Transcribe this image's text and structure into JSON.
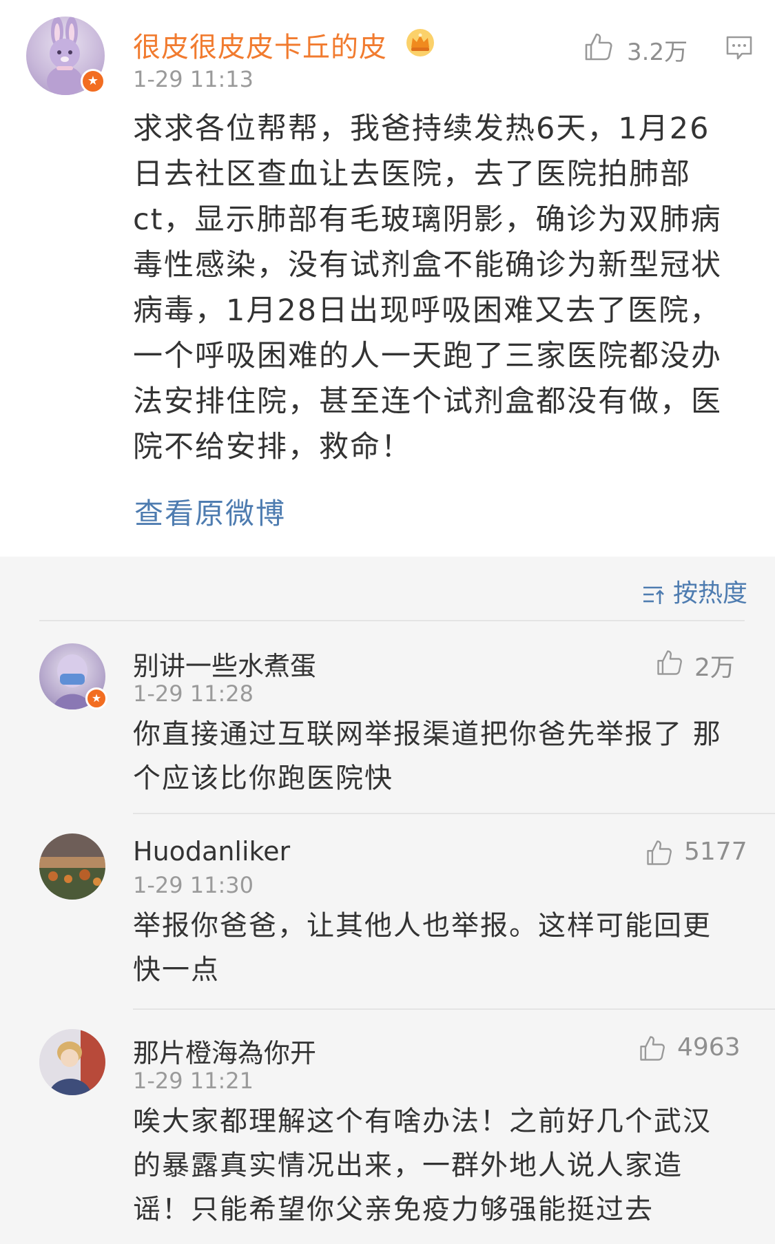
{
  "post": {
    "author": "很皮很皮皮卡丘的皮",
    "time": "1-29 11:13",
    "like_count": "3.2万",
    "text": "求求各位帮帮，我爸持续发热6天，1月26日去社区查血让去医院，去了医院拍肺部ct，显示肺部有毛玻璃阴影，确诊为双肺病毒性感染，没有试剂盒不能确诊为新型冠状病毒，1月28日出现呼吸困难又去了医院，一个呼吸困难的人一天跑了三家医院都没办法安排住院，甚至连个试剂盒都没有做，医院不给安排，救命！",
    "view_original": "查看原微博"
  },
  "sort_label": "按热度",
  "comments": [
    {
      "name": "别讲一些水煮蛋",
      "time": "1-29 11:28",
      "likes": "2万",
      "text": "你直接通过互联网举报渠道把你爸先举报了 那个应该比你跑医院快"
    },
    {
      "name": "Huodanliker",
      "time": "1-29 11:30",
      "likes": "5177",
      "text": "举报你爸爸，让其他人也举报。这样可能回更快一点"
    },
    {
      "name": "那片橙海為你开",
      "time": "1-29 11:21",
      "likes": "4963",
      "text": "唉大家都理解这个有啥办法！之前好几个武汉的暴露真实情况出来，一群外地人说人家造谣！只能希望你父亲免疫力够强能挺过去"
    }
  ],
  "colors": {
    "author_orange": "#f17b2f",
    "link_blue": "#4e7cb0",
    "muted_gray": "#9a9a9a",
    "verified_badge": "#f26d21",
    "comments_bg": "#f5f5f5"
  },
  "icons": {
    "like": "thumbs-up-icon",
    "comment": "comment-icon",
    "crown": "crown-icon",
    "sort": "sort-icon",
    "verified": "verified-badge-icon"
  }
}
